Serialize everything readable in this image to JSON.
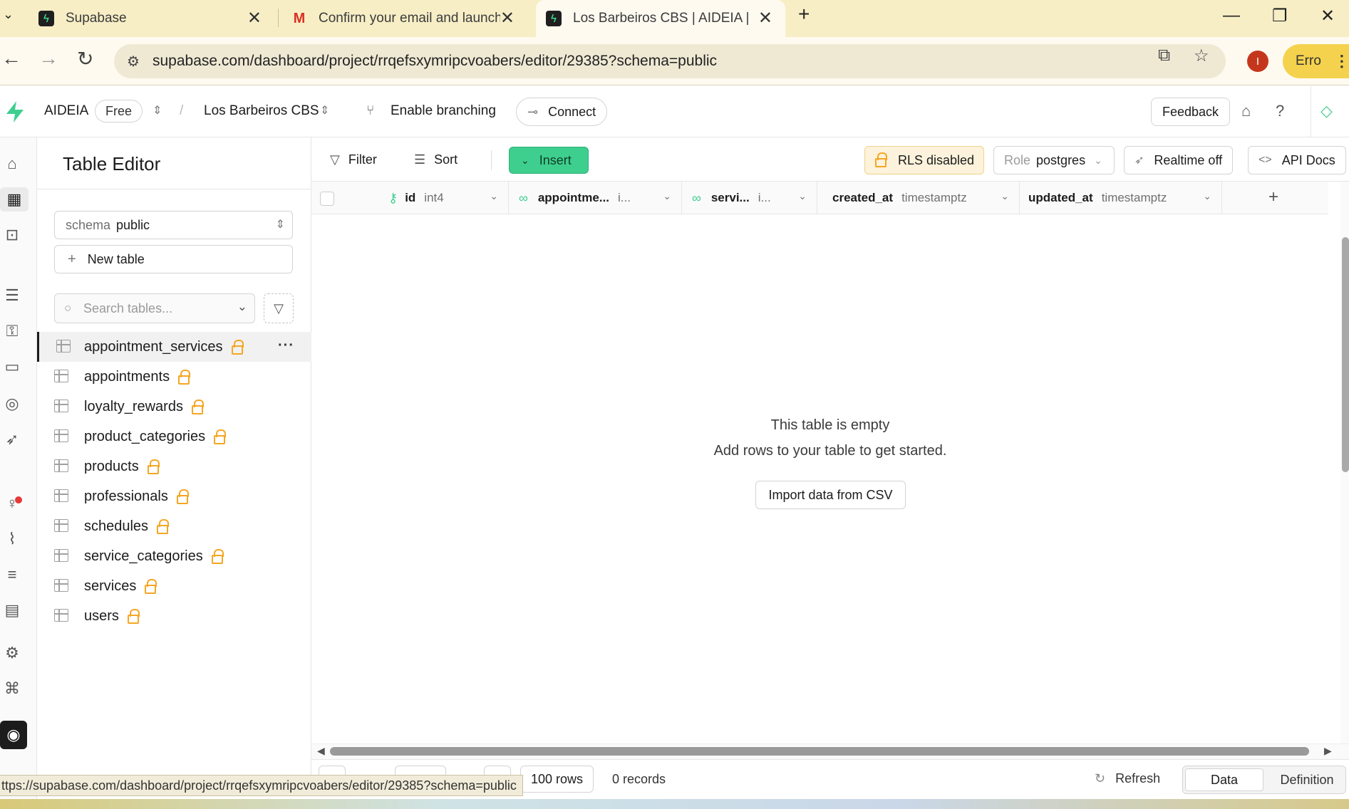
{
  "browser": {
    "tabs": [
      {
        "title": "Supabase",
        "icon": "supabase-icon"
      },
      {
        "title": "Confirm your email and launch",
        "icon": "gmail-icon"
      },
      {
        "title": "Los Barbeiros CBS | AIDEIA | Sup",
        "icon": "supabase-icon",
        "active": true
      }
    ],
    "url": "supabase.com/dashboard/project/rrqefsxymripcvoabers/editor/29385?schema=public",
    "profile_initial": "I",
    "error_label": "Erro",
    "status_url": "ttps://supabase.com/dashboard/project/rrqefsxymripcvoabers/editor/29385?schema=public"
  },
  "header": {
    "org": "AIDEIA",
    "plan": "Free",
    "project": "Los Barbeiros CBS",
    "branching": "Enable branching",
    "connect": "Connect",
    "feedback": "Feedback",
    "brand_color": "#3ecf8e"
  },
  "sidebar": {
    "title": "Table Editor",
    "schema_label": "schema",
    "schema_value": "public",
    "new_table": "New table",
    "search_placeholder": "Search tables...",
    "tables": [
      "appointment_services",
      "appointments",
      "loyalty_rewards",
      "product_categories",
      "products",
      "professionals",
      "schedules",
      "service_categories",
      "services",
      "users"
    ],
    "active_table": "appointment_services"
  },
  "toolbar": {
    "filter": "Filter",
    "sort": "Sort",
    "insert": "Insert",
    "rls": "RLS disabled",
    "role_label": "Role",
    "role_value": "postgres",
    "realtime": "Realtime off",
    "api_docs": "API Docs"
  },
  "columns": [
    {
      "name": "id",
      "type": "int4"
    },
    {
      "name": "appointme...",
      "type": "i..."
    },
    {
      "name": "servi...",
      "type": "i..."
    },
    {
      "name": "created_at",
      "type": "timestamptz"
    },
    {
      "name": "updated_at",
      "type": "timestamptz"
    }
  ],
  "empty_state": {
    "line1": "This table is empty",
    "line2": "Add rows to your table to get started.",
    "import_button": "Import data from CSV"
  },
  "footer": {
    "rows": "100 rows",
    "records": "0 records",
    "refresh": "Refresh",
    "view_data": "Data",
    "view_definition": "Definition"
  }
}
